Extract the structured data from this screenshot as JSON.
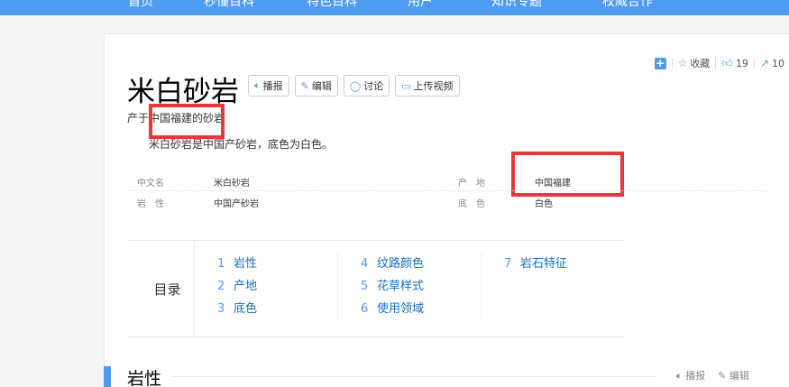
{
  "nav": {
    "items": [
      "首页",
      "秒懂百科",
      "特色百科",
      "用户",
      "知识专题",
      "权威合作"
    ]
  },
  "actions": {
    "favorite": "收藏",
    "like_count": "19",
    "share_count": "10"
  },
  "title": "米白砂岩",
  "buttons": {
    "report": "播报",
    "edit": "编辑",
    "discuss": "讨论",
    "upload_video": "上传视频"
  },
  "subtitle": "产于中国福建的砂岩",
  "summary": "米白砂岩是中国产砂岩，底色为白色。",
  "info": {
    "k1": "中文名",
    "v1": "米白砂岩",
    "k2": "产　地",
    "v2": "中国福建",
    "k3": "岩　性",
    "v3": "中国产砂岩",
    "k4": "底　色",
    "v4": "白色"
  },
  "toc": {
    "label": "目录",
    "col1": [
      {
        "num": "1",
        "label": "岩性"
      },
      {
        "num": "2",
        "label": "产地"
      },
      {
        "num": "3",
        "label": "底色"
      }
    ],
    "col2": [
      {
        "num": "4",
        "label": "纹路颜色"
      },
      {
        "num": "5",
        "label": "花草样式"
      },
      {
        "num": "6",
        "label": "使用领域"
      }
    ],
    "col3": [
      {
        "num": "7",
        "label": "岩石特征"
      }
    ]
  },
  "section": {
    "title": "岩性",
    "report": "播报",
    "edit": "编辑"
  },
  "colors": {
    "accent": "#4f9cee",
    "highlight": "#e6383a",
    "link": "#136ec2"
  }
}
